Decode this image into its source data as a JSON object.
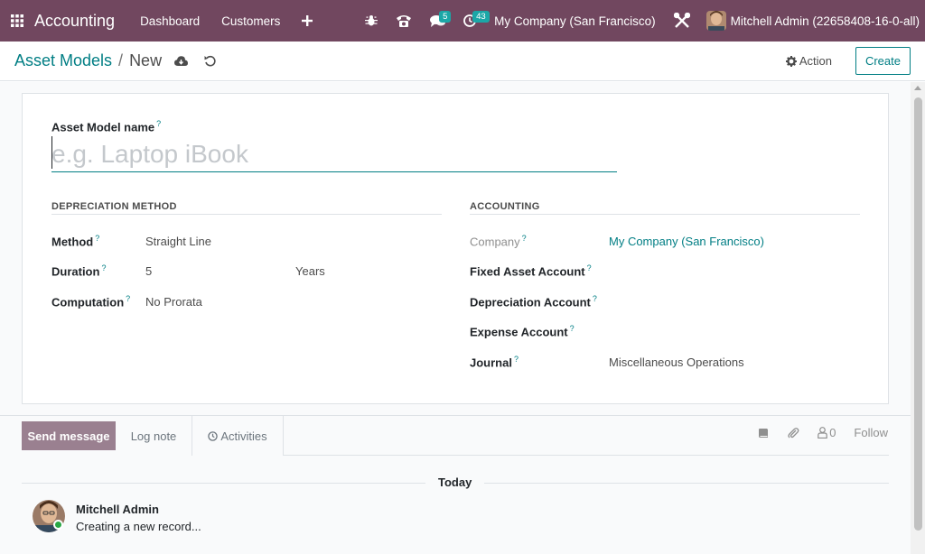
{
  "navbar": {
    "brand": "Accounting",
    "menu": [
      "Dashboard",
      "Customers"
    ],
    "messages_count": "5",
    "activities_count": "43",
    "company": "My Company (San Francisco)",
    "user": "Mitchell Admin (22658408-16-0-all)"
  },
  "control": {
    "breadcrumb_parent": "Asset Models",
    "breadcrumb_sep": "/",
    "breadcrumb_current": "New",
    "action_label": "Action",
    "create_label": "Create"
  },
  "form": {
    "name_label": "Asset Model name",
    "name_placeholder": "e.g. Laptop iBook",
    "name_value": "",
    "depreciation": {
      "title": "DEPRECIATION METHOD",
      "method_label": "Method",
      "method_value": "Straight Line",
      "duration_label": "Duration",
      "duration_value": "5",
      "duration_unit": "Years",
      "computation_label": "Computation",
      "computation_value": "No Prorata"
    },
    "accounting": {
      "title": "ACCOUNTING",
      "company_label": "Company",
      "company_value": "My Company (San Francisco)",
      "fixed_asset_label": "Fixed Asset Account",
      "depreciation_account_label": "Depreciation Account",
      "expense_account_label": "Expense Account",
      "journal_label": "Journal",
      "journal_value": "Miscellaneous Operations"
    },
    "help_marker": "?"
  },
  "chatter": {
    "send_message": "Send message",
    "log_note": "Log note",
    "activities": "Activities",
    "followers_count": "0",
    "follow": "Follow",
    "today": "Today",
    "message_author": "Mitchell Admin",
    "message_body": "Creating a new record..."
  },
  "colors": {
    "navbar": "#71475f",
    "accent": "#017e84",
    "send_button": "#9a8090",
    "badge": "#1ba7a7"
  }
}
